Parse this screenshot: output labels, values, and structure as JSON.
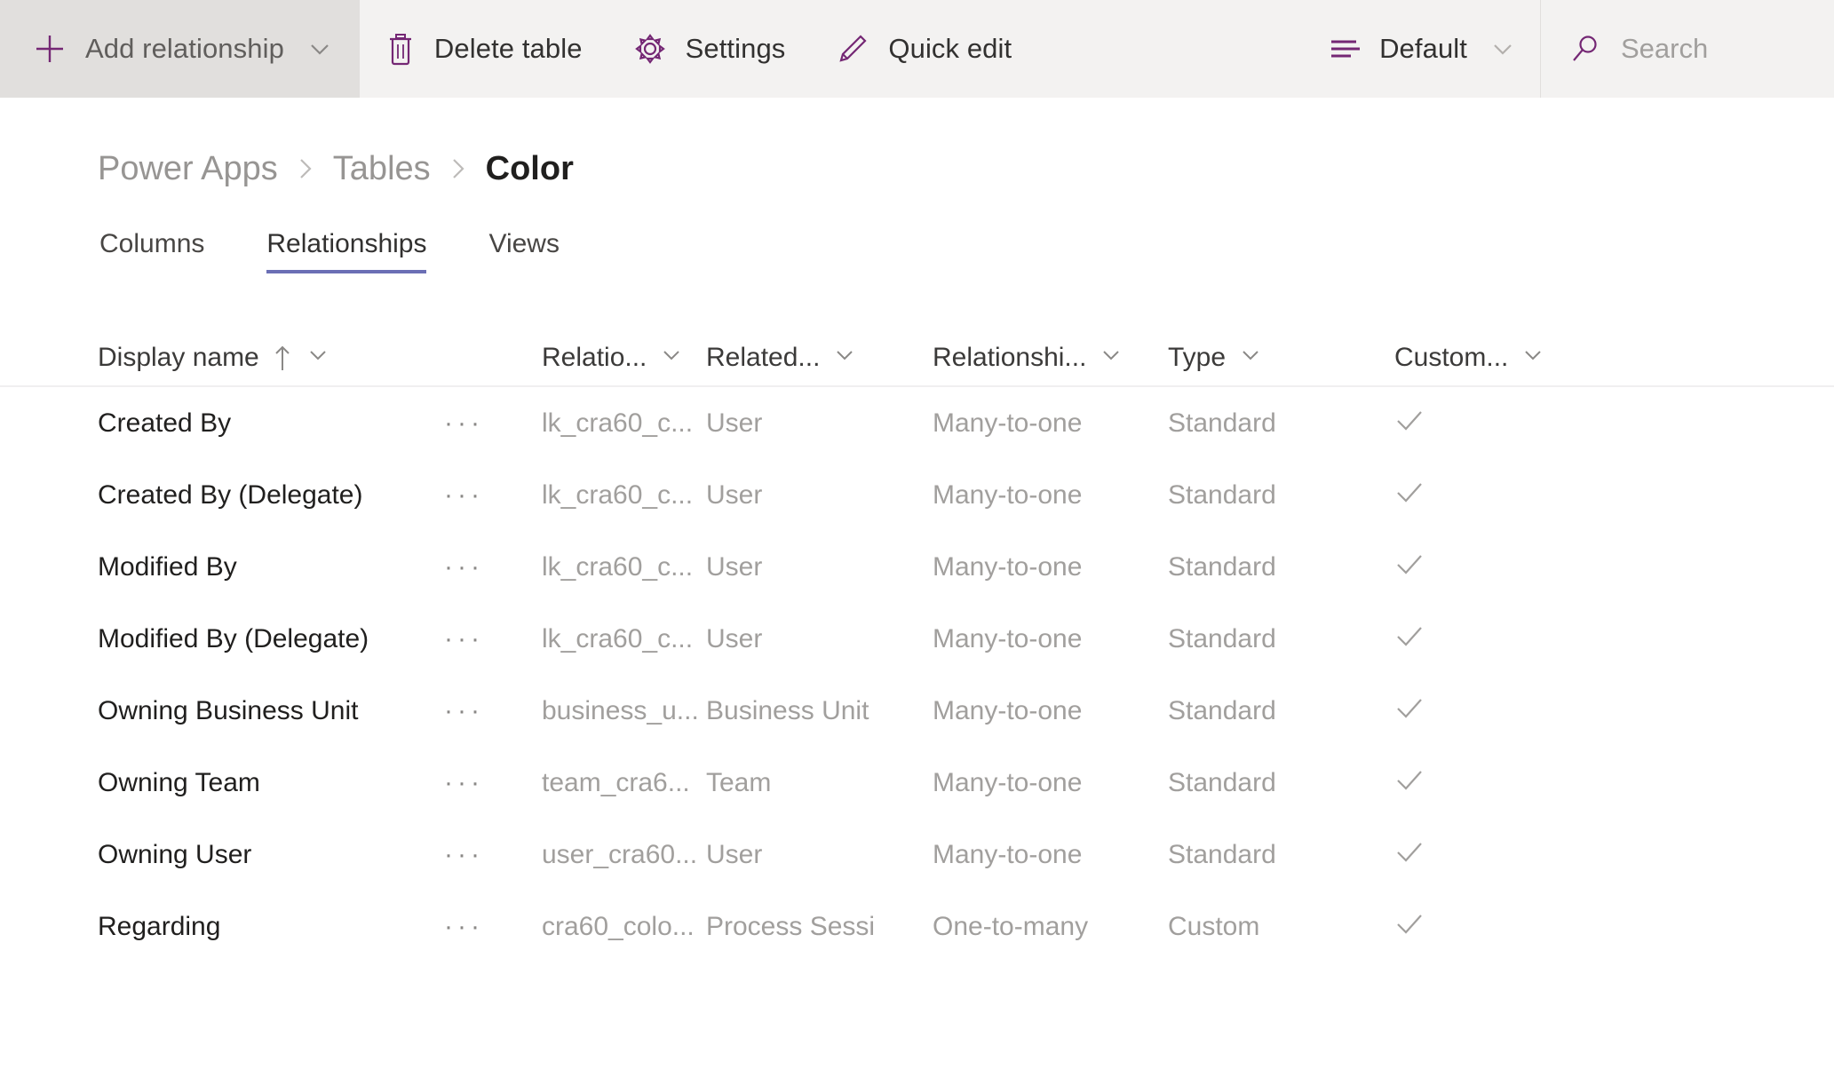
{
  "command_bar": {
    "add_relationship": {
      "label": "Add relationship",
      "icon": "plus-icon",
      "chevron": "chevron-down-icon"
    },
    "delete_table": {
      "label": "Delete table",
      "icon": "trash-icon"
    },
    "settings": {
      "label": "Settings",
      "icon": "gear-icon"
    },
    "quick_edit": {
      "label": "Quick edit",
      "icon": "pencil-icon"
    },
    "view_selector": {
      "label": "Default",
      "icon": "view-list-icon",
      "chevron": "chevron-down-icon"
    },
    "search": {
      "placeholder": "Search",
      "value": "",
      "icon": "search-icon"
    }
  },
  "breadcrumb": {
    "items": [
      {
        "label": "Power Apps",
        "current": false
      },
      {
        "label": "Tables",
        "current": false
      },
      {
        "label": "Color",
        "current": true
      }
    ],
    "separator": "›"
  },
  "tabs": [
    {
      "label": "Columns",
      "active": false
    },
    {
      "label": "Relationships",
      "active": true
    },
    {
      "label": "Views",
      "active": false
    }
  ],
  "grid": {
    "columns": [
      {
        "label": "Display name",
        "sorted": "ascending",
        "sort_icon": "arrow-up-icon",
        "chevron": "chevron-down-icon"
      },
      {
        "label": "Relatio...",
        "chevron": "chevron-down-icon"
      },
      {
        "label": "Related...",
        "chevron": "chevron-down-icon"
      },
      {
        "label": "Relationshi...",
        "chevron": "chevron-down-icon"
      },
      {
        "label": "Type",
        "chevron": "chevron-down-icon"
      },
      {
        "label": "Custom...",
        "chevron": "chevron-down-icon"
      }
    ],
    "row_menu_glyph": "···",
    "customizable_glyph": "check-icon",
    "rows": [
      {
        "display_name": "Created By",
        "relationship_name": "lk_cra60_c...",
        "related_table": "User",
        "relationship_type": "Many-to-one",
        "type": "Standard",
        "customizable": true
      },
      {
        "display_name": "Created By (Delegate)",
        "relationship_name": "lk_cra60_c...",
        "related_table": "User",
        "relationship_type": "Many-to-one",
        "type": "Standard",
        "customizable": true
      },
      {
        "display_name": "Modified By",
        "relationship_name": "lk_cra60_c...",
        "related_table": "User",
        "relationship_type": "Many-to-one",
        "type": "Standard",
        "customizable": true
      },
      {
        "display_name": "Modified By (Delegate)",
        "relationship_name": "lk_cra60_c...",
        "related_table": "User",
        "relationship_type": "Many-to-one",
        "type": "Standard",
        "customizable": true
      },
      {
        "display_name": "Owning Business Unit",
        "relationship_name": "business_u...",
        "related_table": "Business Unit",
        "relationship_type": "Many-to-one",
        "type": "Standard",
        "customizable": true
      },
      {
        "display_name": "Owning Team",
        "relationship_name": "team_cra6...",
        "related_table": "Team",
        "relationship_type": "Many-to-one",
        "type": "Standard",
        "customizable": true
      },
      {
        "display_name": "Owning User",
        "relationship_name": "user_cra60...",
        "related_table": "User",
        "relationship_type": "Many-to-one",
        "type": "Standard",
        "customizable": true
      },
      {
        "display_name": "Regarding",
        "relationship_name": "cra60_colo...",
        "related_table": "Process Sessi",
        "relationship_type": "One-to-many",
        "type": "Custom",
        "customizable": true
      }
    ]
  },
  "colors": {
    "accent_purple": "#742774",
    "tab_underline": "#6b6fb5",
    "command_bar_bg": "#f3f2f1",
    "button_hover_bg": "#e1dfdd",
    "primary_text": "#201f1e",
    "secondary_text": "#a19f9d"
  }
}
